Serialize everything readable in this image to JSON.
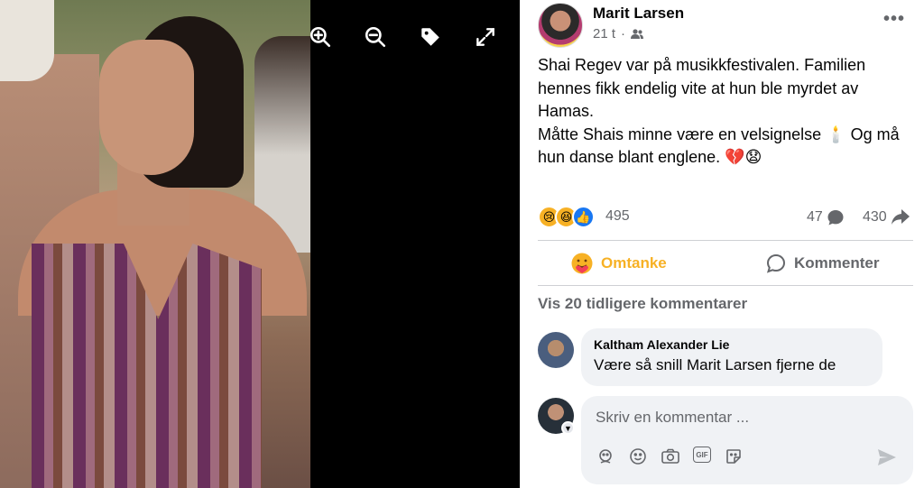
{
  "viewer": {
    "tools": [
      {
        "name": "zoom-in-icon"
      },
      {
        "name": "zoom-out-icon"
      },
      {
        "name": "tag-icon"
      },
      {
        "name": "fullscreen-icon"
      }
    ]
  },
  "post": {
    "author": "Marit Larsen",
    "time": "21 t",
    "audience_icon": "friends-icon",
    "more": "•••",
    "text_lines": [
      "Shai Regev var på musikkfestivalen. Familien hennes fikk endelig vite at hun ble myrdet av Hamas.",
      "Måtte Shais minne være en velsignelse 🕯️ Og må hun danse blant englene. 💔😧"
    ],
    "reactions": {
      "icons": [
        "😢",
        "😆",
        "👍"
      ],
      "colors": [
        "#f7b125",
        "#f7b125",
        "#1877f2"
      ],
      "count": "495"
    },
    "comments_count": "47",
    "shares_count": "430"
  },
  "actions": {
    "care_label": "Omtanke",
    "comment_label": "Kommenter"
  },
  "comments": {
    "previous_label": "Vis 20 tidligere kommentarer",
    "items": [
      {
        "author": "Kaltham Alexander Lie",
        "text": "Være så snill Marit Larsen fjerne de"
      }
    ]
  },
  "composer": {
    "placeholder": "Skriv en kommentar ...",
    "tools": [
      "avatar-sticker-icon",
      "emoji-icon",
      "camera-icon",
      "gif-icon",
      "sticker-icon"
    ],
    "gif_label": "GIF"
  }
}
